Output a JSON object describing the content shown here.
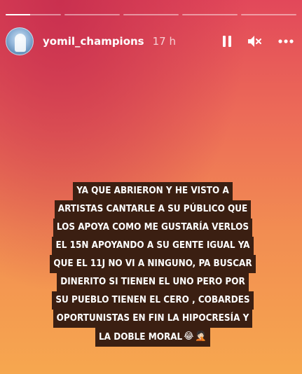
{
  "story": {
    "progress_segments": [
      {
        "fill": 0.44
      },
      {
        "fill": 0
      },
      {
        "fill": 0
      },
      {
        "fill": 0
      },
      {
        "fill": 0
      }
    ]
  },
  "header": {
    "username": "yomil_champions",
    "time": "17 h"
  },
  "icons": {
    "pause": "pause-icon",
    "mute": "mute-icon",
    "more": "more-icon"
  },
  "caption": {
    "lines": [
      "YA QUE ABRIERON Y HE VISTO A",
      "ARTISTAS CANTARLE A SU PÚBLICO  QUE",
      "LOS APOYA COMO ME GUSTARÍA VERLOS",
      "EL 15N APOYANDO A SU GENTE IGUAL YA",
      "QUE EL 11J NO VI A NINGUNO, PA BUSCAR",
      "DINERITO SI TIENEN EL UNO PERO POR",
      "SU PUEBLO TIENEN EL CERO , COBARDES",
      "OPORTUNISTAS EN FIN LA HIPOCRESÍA Y",
      "LA DOBLE MORAL"
    ],
    "emojis": [
      "😂",
      "🤦🏻"
    ]
  }
}
